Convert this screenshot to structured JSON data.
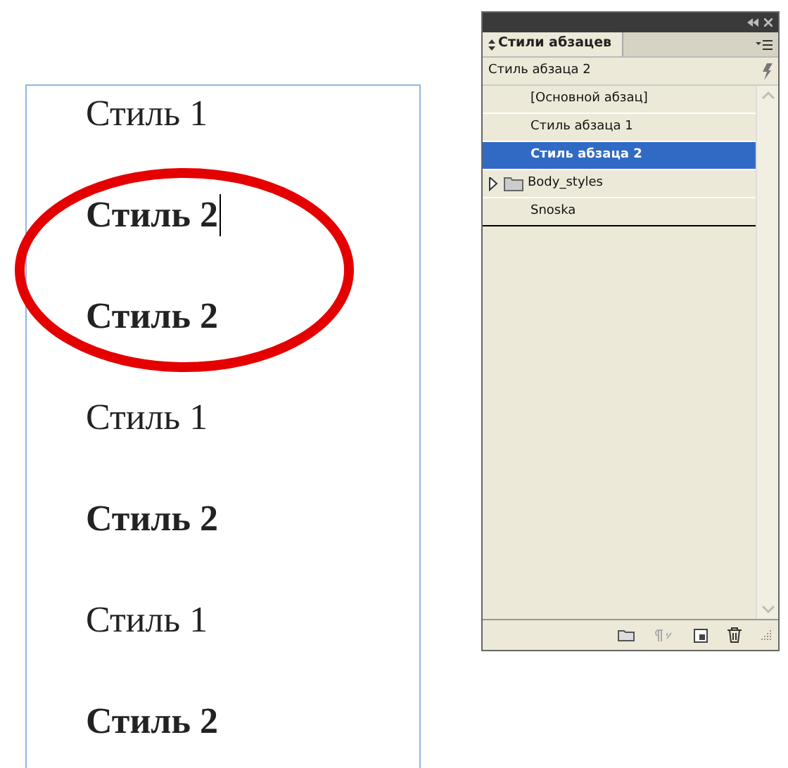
{
  "document": {
    "paragraphs": [
      {
        "text": "Стиль 1",
        "bold": false,
        "cursor": false
      },
      {
        "text": "Стиль 2",
        "bold": true,
        "cursor": true
      },
      {
        "text": "Стиль 2",
        "bold": true,
        "cursor": false
      },
      {
        "text": "Стиль 1",
        "bold": false,
        "cursor": false
      },
      {
        "text": "Стиль 2",
        "bold": true,
        "cursor": false
      },
      {
        "text": "Стиль 1",
        "bold": false,
        "cursor": false
      },
      {
        "text": "Стиль 2",
        "bold": true,
        "cursor": false
      }
    ],
    "highlight_ellipse": true
  },
  "panel": {
    "title": "Стили абзацев",
    "current_style": "Стиль абзаца 2",
    "items": [
      {
        "kind": "style",
        "label": "[Основной абзац]",
        "selected": false
      },
      {
        "kind": "style",
        "label": "Стиль абзаца 1",
        "selected": false
      },
      {
        "kind": "style",
        "label": "Стиль абзаца 2",
        "selected": true
      },
      {
        "kind": "group",
        "label": "Body_styles",
        "selected": false,
        "expanded": false
      },
      {
        "kind": "style",
        "label": "Snoska",
        "selected": false
      }
    ]
  }
}
